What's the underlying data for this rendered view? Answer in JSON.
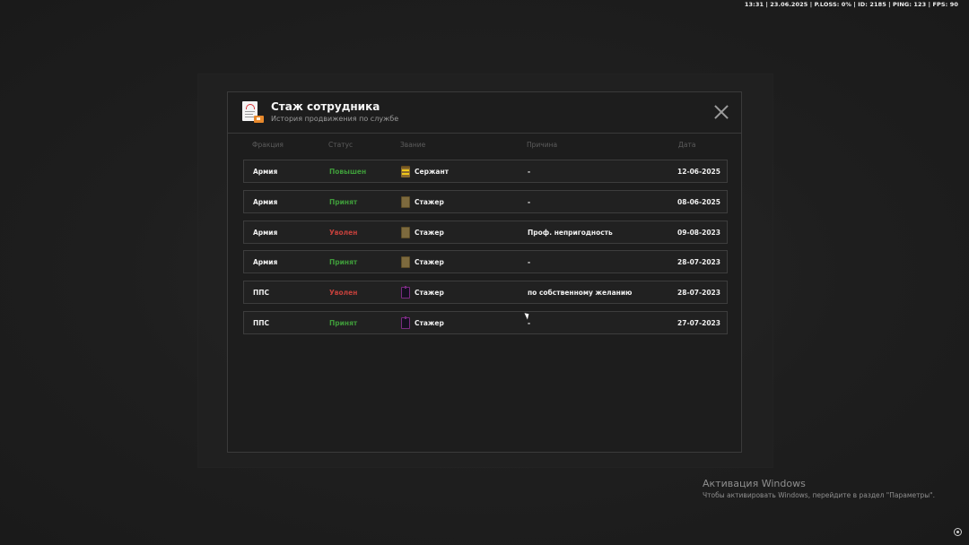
{
  "hud": {
    "text": "13:31 | 23.06.2025 | P.LOSS: 0% | ID: 2185 | PING: 123 | FPS: 90"
  },
  "modal": {
    "title": "Стаж сотрудника",
    "subtitle": "История продвижения по службе",
    "icon": "document-stamp-icon",
    "close_icon": "close-icon"
  },
  "columns": {
    "faction": "Фракция",
    "status": "Статус",
    "rank": "Звание",
    "reason": "Причина",
    "date": "Дата"
  },
  "rows": [
    {
      "faction": "Армия",
      "status": "Повышен",
      "status_color": "#3f9b3a",
      "rank": "Сержант",
      "rank_icon": "sergeant-insignia-icon",
      "reason": "-",
      "date": "12-06-2025"
    },
    {
      "faction": "Армия",
      "status": "Принят",
      "status_color": "#3f9b3a",
      "rank": "Стажер",
      "rank_icon": "army-insignia-icon",
      "reason": "-",
      "date": "08-06-2025"
    },
    {
      "faction": "Армия",
      "status": "Уволен",
      "status_color": "#c2403b",
      "rank": "Стажер",
      "rank_icon": "army-insignia-icon",
      "reason": "Проф. непригодность",
      "date": "09-08-2023"
    },
    {
      "faction": "Армия",
      "status": "Принят",
      "status_color": "#3f9b3a",
      "rank": "Стажер",
      "rank_icon": "army-insignia-icon",
      "reason": "-",
      "date": "28-07-2023"
    },
    {
      "faction": "ППС",
      "status": "Уволен",
      "status_color": "#c2403b",
      "rank": "Стажер",
      "rank_icon": "pps-insignia-icon",
      "reason": "по собственному желанию",
      "date": "28-07-2023"
    },
    {
      "faction": "ППС",
      "status": "Принят",
      "status_color": "#3f9b3a",
      "rank": "Стажер",
      "rank_icon": "pps-insignia-icon",
      "reason": "-",
      "date": "27-07-2023"
    }
  ],
  "watermark": {
    "title": "Активация Windows",
    "subtitle": "Чтобы активировать Windows, перейдите в раздел \"Параметры\"."
  }
}
